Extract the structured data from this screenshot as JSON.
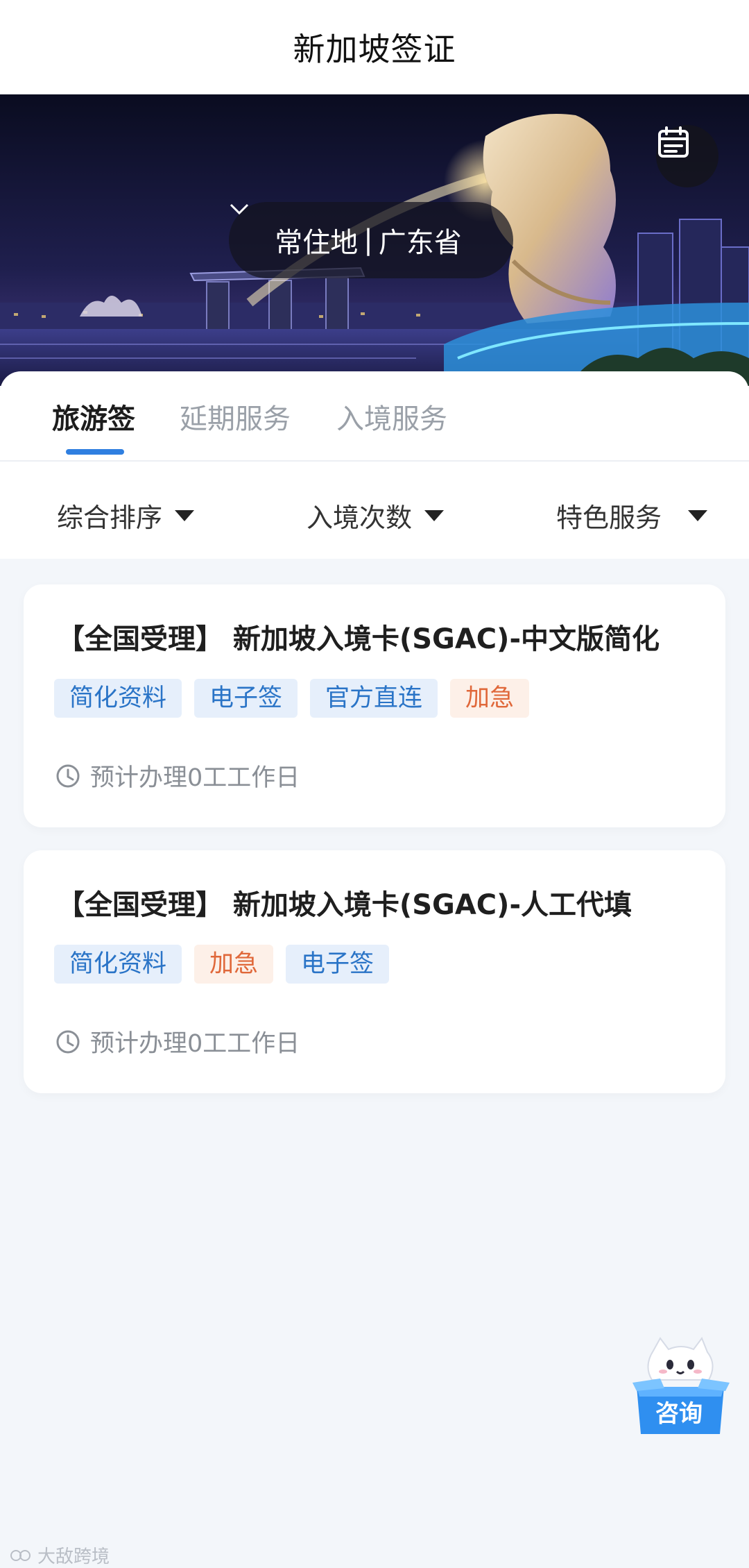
{
  "header": {
    "title": "新加坡签证"
  },
  "hero": {
    "location_label": "常住地",
    "location_separator": "|",
    "location_value": "广东省",
    "calendar_icon": "calendar-icon",
    "chevron_icon": "chevron-down-icon"
  },
  "tabs": [
    {
      "label": "旅游签",
      "active": true
    },
    {
      "label": "延期服务",
      "active": false
    },
    {
      "label": "入境服务",
      "active": false
    }
  ],
  "filters": [
    {
      "label": "综合排序",
      "icon": "caret-down-icon"
    },
    {
      "label": "入境次数",
      "icon": "caret-down-icon"
    },
    {
      "label": "特色服务",
      "icon": "caret-down-icon"
    }
  ],
  "products": [
    {
      "title": "【全国受理】 新加坡入境卡(SGAC)-中文版简化",
      "tags": [
        {
          "label": "简化资料",
          "color": "#2a74c7"
        },
        {
          "label": "电子签",
          "color": "#2a74c7"
        },
        {
          "label": "官方直连",
          "color": "#2a74c7"
        },
        {
          "label": "加急",
          "color": "#e0683a"
        }
      ],
      "eta": "预计办理0工工作日"
    },
    {
      "title": "【全国受理】 新加坡入境卡(SGAC)-人工代填",
      "tags": [
        {
          "label": "简化资料",
          "color": "#2a74c7"
        },
        {
          "label": "加急",
          "color": "#e0683a"
        },
        {
          "label": "电子签",
          "color": "#2a74c7"
        }
      ],
      "eta": "预计办理0工工作日"
    }
  ],
  "consult": {
    "label": "咨询",
    "icon": "mascot-icon"
  },
  "watermark": {
    "text": "大敌跨境"
  },
  "colors": {
    "accent": "#2f7fe0",
    "tag_blue_bg": "#e6effb",
    "tag_orange_bg": "#fdf0e8",
    "page_bg": "#f3f6fa"
  }
}
